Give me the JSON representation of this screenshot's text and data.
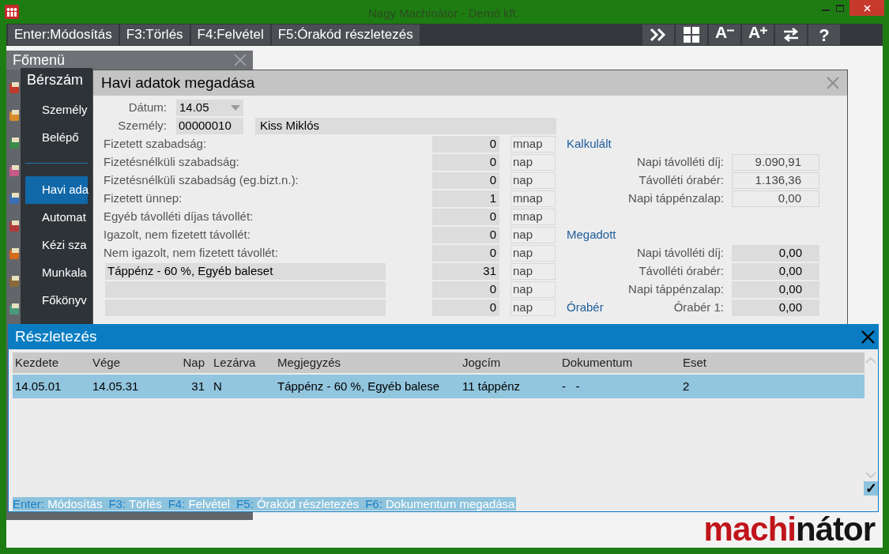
{
  "window": {
    "title": "Nagy Machinátor - Demó kft."
  },
  "toolbar": {
    "actions": [
      {
        "key": "Enter:",
        "label": "Módosítás"
      },
      {
        "key": "F3:",
        "label": "Törlés"
      },
      {
        "key": "F4:",
        "label": "Felvétel"
      },
      {
        "key": "F5:",
        "label": "Órakód részletezés"
      }
    ],
    "icon_buttons": [
      {
        "kind": "forward"
      },
      {
        "kind": "grid"
      },
      {
        "kind": "font-smaller",
        "glyph": "A"
      },
      {
        "kind": "font-larger",
        "glyph": "A"
      },
      {
        "kind": "swap"
      },
      {
        "kind": "help",
        "glyph": "?"
      }
    ]
  },
  "main_menu": {
    "title": "Főmenü",
    "submenu": {
      "title": "Bérszám",
      "groups": [
        [
          {
            "label": "Személy",
            "selected": false
          },
          {
            "label": "Belépő",
            "selected": false
          }
        ],
        [
          {
            "label": "Havi ada",
            "selected": true
          },
          {
            "label": "Automat",
            "selected": false
          },
          {
            "label": "Kézi sza",
            "selected": false
          },
          {
            "label": "Munkala",
            "selected": false
          },
          {
            "label": "Főkönyv",
            "selected": false
          }
        ]
      ]
    }
  },
  "dialog": {
    "title": "Havi adatok megadása",
    "date": {
      "label": "Dátum:",
      "value": "14.05"
    },
    "person": {
      "label": "Személy:",
      "code": "00000010",
      "name": "Kiss Miklós"
    },
    "rows": [
      {
        "kind": "fixed",
        "label": "Fizetett szabadság:",
        "value": "0",
        "unit": "mnap"
      },
      {
        "kind": "fixed",
        "label": "Fizetésnélküli szabadság:",
        "value": "0",
        "unit": "nap"
      },
      {
        "kind": "fixed",
        "label": "Fizetésnélküli szabadság (eg.bizt.n.):",
        "value": "0",
        "unit": "nap"
      },
      {
        "kind": "fixed",
        "label": "Fizetett ünnep:",
        "value": "1",
        "unit": "mnap"
      },
      {
        "kind": "fixed",
        "label": "Egyéb távolléti díjas távollét:",
        "value": "0",
        "unit": "mnap"
      },
      {
        "kind": "fixed",
        "label": "Igazolt, nem fizetett távollét:",
        "value": "0",
        "unit": "nap"
      },
      {
        "kind": "fixed",
        "label": "Nem igazolt, nem fizetett távollét:",
        "value": "0",
        "unit": "nap"
      },
      {
        "kind": "editable",
        "label": "Táppénz - 60 %, Egyéb baleset",
        "value": "31",
        "unit": "nap"
      },
      {
        "kind": "editable",
        "value": "0",
        "unit": "nap"
      },
      {
        "kind": "editable",
        "value": "0",
        "unit": "nap"
      }
    ],
    "sections": [
      {
        "title": "Kalkulált",
        "kind": "calculated",
        "fields": [
          {
            "label": "Napi távolléti díj:",
            "value": "9.090,91"
          },
          {
            "label": "Távolléti órabér:",
            "value": "1.136,36"
          },
          {
            "label": "Napi táppénzalap:",
            "value": "0,00"
          }
        ]
      },
      {
        "title": "Megadott",
        "kind": "entered",
        "fields": [
          {
            "label": "Napi távolléti díj:",
            "value": "0,00"
          },
          {
            "label": "Távolléti órabér:",
            "value": "0,00"
          },
          {
            "label": "Napi táppénzalap:",
            "value": "0,00"
          }
        ]
      },
      {
        "title": "Órabér",
        "kind": "inline",
        "fields": [
          {
            "label": "Órabér 1:",
            "value": "0,00"
          }
        ]
      }
    ]
  },
  "details": {
    "title": "Részletezés",
    "table": {
      "columns": [
        "Kezdete",
        "Vége",
        "Nap",
        "Lezárva",
        "Megjegyzés",
        "Jogcím",
        "Dokumentum",
        "Eset"
      ],
      "rows": [
        {
          "selected": true,
          "cells": [
            "14.05.01",
            "14.05.31",
            "31",
            "N",
            "Táppénz - 60 %, Egyéb balese",
            "11 táppénz",
            "-   -",
            "2"
          ]
        }
      ]
    },
    "confirm": {
      "checked": true,
      "glyph": "✓"
    },
    "status_bar": [
      {
        "key": "Enter:",
        "label": "Módosítás"
      },
      {
        "key": "F3:",
        "label": "Törlés"
      },
      {
        "key": "F4:",
        "label": "Felvétel"
      },
      {
        "key": "F5:",
        "label": "Órakód részletezés"
      },
      {
        "key": "F6:",
        "label": "Dokumentum megadása"
      }
    ]
  },
  "logo": {
    "accent": "machi",
    "rest": "nátor"
  }
}
